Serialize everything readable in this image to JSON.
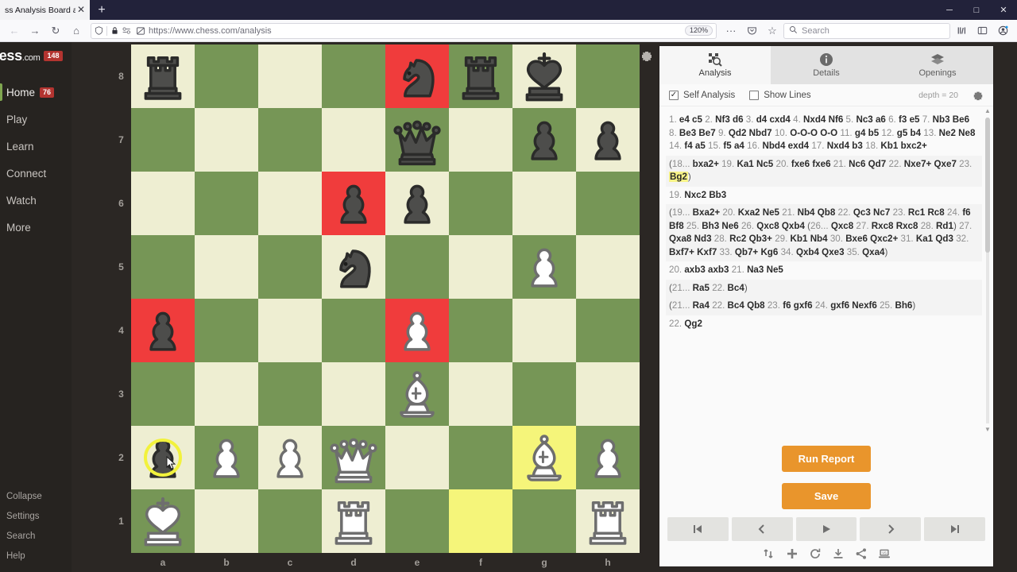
{
  "browser": {
    "tab_title": "ss Analysis Board and PGN",
    "tab_close": "✕",
    "new_tab": "+",
    "back": "←",
    "forward": "→",
    "reload": "↻",
    "home": "⌂",
    "url": "https://www.chess.com/analysis",
    "zoom_level": "120%",
    "menu_dots": "···",
    "pocket_icon": "pocket-icon",
    "bookmark_star": "☆",
    "search_placeholder": "Search",
    "library_icon": "library-icon",
    "sidebar_icon": "sidebar-icon",
    "account_icon": "account-icon",
    "minimize": "─",
    "maximize": "□",
    "close": "✕"
  },
  "sidebar": {
    "brand": "hess",
    "brand_suffix": ".com",
    "brand_badge": "148",
    "items": [
      {
        "label": "Home",
        "badge": "76",
        "active": true
      },
      {
        "label": "Play",
        "badge": "",
        "active": false
      },
      {
        "label": "Learn",
        "badge": "",
        "active": false
      },
      {
        "label": "Connect",
        "badge": "",
        "active": false
      },
      {
        "label": "Watch",
        "badge": "",
        "active": false
      },
      {
        "label": "More",
        "badge": "",
        "active": false
      }
    ],
    "footer": [
      "Collapse",
      "Settings",
      "Search",
      "Help"
    ]
  },
  "board": {
    "gear_icon": "gear-icon",
    "ranks": [
      "8",
      "7",
      "6",
      "5",
      "4",
      "3",
      "2",
      "1"
    ],
    "files": [
      "a",
      "b",
      "c",
      "d",
      "e",
      "f",
      "g",
      "h"
    ],
    "light_color": "#eeeed2",
    "dark_color": "#769656",
    "highlight_red": "#f03c3c",
    "highlight_yellow": "#f5f57a",
    "select_ring_color": "#f2f23c",
    "squares": [
      {
        "sq": "a8",
        "piece": "black-rook"
      },
      {
        "sq": "e8",
        "piece": "black-knight",
        "highlight": "red"
      },
      {
        "sq": "f8",
        "piece": "black-rook"
      },
      {
        "sq": "g8",
        "piece": "black-king"
      },
      {
        "sq": "e7",
        "piece": "black-queen"
      },
      {
        "sq": "g7",
        "piece": "black-pawn"
      },
      {
        "sq": "h7",
        "piece": "black-pawn"
      },
      {
        "sq": "d6",
        "piece": "black-pawn",
        "highlight": "red"
      },
      {
        "sq": "e6",
        "piece": "black-pawn"
      },
      {
        "sq": "d5",
        "piece": "black-knight"
      },
      {
        "sq": "g5",
        "piece": "white-pawn"
      },
      {
        "sq": "a4",
        "piece": "black-pawn",
        "highlight": "red"
      },
      {
        "sq": "e4",
        "piece": "white-pawn",
        "highlight": "red"
      },
      {
        "sq": "e3",
        "piece": "white-bishop"
      },
      {
        "sq": "a2",
        "piece": "black-pawn",
        "selected": true,
        "cursor": true
      },
      {
        "sq": "b2",
        "piece": "white-pawn"
      },
      {
        "sq": "c2",
        "piece": "white-pawn"
      },
      {
        "sq": "d2",
        "piece": "white-queen"
      },
      {
        "sq": "g2",
        "piece": "white-bishop",
        "highlight": "yellow"
      },
      {
        "sq": "h2",
        "piece": "white-pawn"
      },
      {
        "sq": "a1",
        "piece": "white-king"
      },
      {
        "sq": "d1",
        "piece": "white-rook"
      },
      {
        "sq": "f1",
        "piece": "",
        "highlight": "yellow"
      },
      {
        "sq": "h1",
        "piece": "white-rook"
      }
    ]
  },
  "panel": {
    "tabs": [
      {
        "label": "Analysis",
        "icon": "analysis-magnifier-icon",
        "active": true
      },
      {
        "label": "Details",
        "icon": "info-circle-icon",
        "active": false
      },
      {
        "label": "Openings",
        "icon": "books-stack-icon",
        "active": false
      }
    ],
    "self_analysis_label": "Self Analysis",
    "self_analysis_checked": true,
    "self_analysis_mark": "✓",
    "show_lines_label": "Show Lines",
    "show_lines_checked": false,
    "depth_label": "depth = 20",
    "settings_icon": "gear-icon",
    "move_blocks": [
      {
        "kind": "main",
        "text": "1. e4 c5 2. Nf3 d6 3. d4 cxd4 4. Nxd4 Nf6 5. Nc3 a6 6. f3 e5 7. Nb3 Be6 8. Be3 Be7 9. Qd2 Nbd7 10. O-O-O O-O 11. g4 b5 12. g5 b4 13. Ne2 Ne8 14. f4 a5 15. f5 a4 16. Nbd4 exd4 17. Nxd4 b3 18. Kb1 bxc2+"
      },
      {
        "kind": "var",
        "text": "(18... bxa2+ 19. Ka1 Nc5 20. fxe6 fxe6 21. Nc6 Qd7 22. Nxe7+ Qxe7 23. Bg2)",
        "highlight_move": "Bg2"
      },
      {
        "kind": "main",
        "text": "19. Nxc2 Bb3"
      },
      {
        "kind": "var",
        "text": "(19... Bxa2+ 20. Kxa2 Ne5 21. Nb4 Qb8 22. Qc3 Nc7 23. Rc1 Rc8 24. f6 Bf8 25. Bh3 Ne6 26. Qxc8 Qxb4 (26... Qxc8 27. Rxc8 Rxc8 28. Rd1) 27. Qxa8 Nd3 28. Rc2 Qb3+ 29. Kb1 Nb4 30. Bxe6 Qxc2+ 31. Ka1 Qd3 32. Bxf7+ Kxf7 33. Qb7+ Kg6 34. Qxb4 Qxe3 35. Qxa4)"
      },
      {
        "kind": "main",
        "text": "20. axb3 axb3 21. Na3 Ne5"
      },
      {
        "kind": "var",
        "text": "(21... Ra5 22. Bc4)"
      },
      {
        "kind": "var",
        "text": "(21... Ra4 22. Bc4 Qb8 23. f6 gxf6 24. gxf6 Nexf6 25. Bh6)"
      },
      {
        "kind": "main",
        "text": "22. Qg2"
      }
    ],
    "run_report_label": "Run Report",
    "save_label": "Save",
    "accent_color": "#e9952c",
    "nav_buttons": [
      {
        "name": "first-move-button",
        "icon": "skip-to-start-icon"
      },
      {
        "name": "previous-move-button",
        "icon": "chevron-left-icon"
      },
      {
        "name": "play-button",
        "icon": "play-icon"
      },
      {
        "name": "next-move-button",
        "icon": "chevron-right-icon"
      },
      {
        "name": "last-move-button",
        "icon": "skip-to-end-icon"
      }
    ],
    "tool_icons": [
      "flip-board-icon",
      "add-icon",
      "refresh-icon",
      "download-icon",
      "share-icon",
      "vs-computer-icon"
    ]
  }
}
